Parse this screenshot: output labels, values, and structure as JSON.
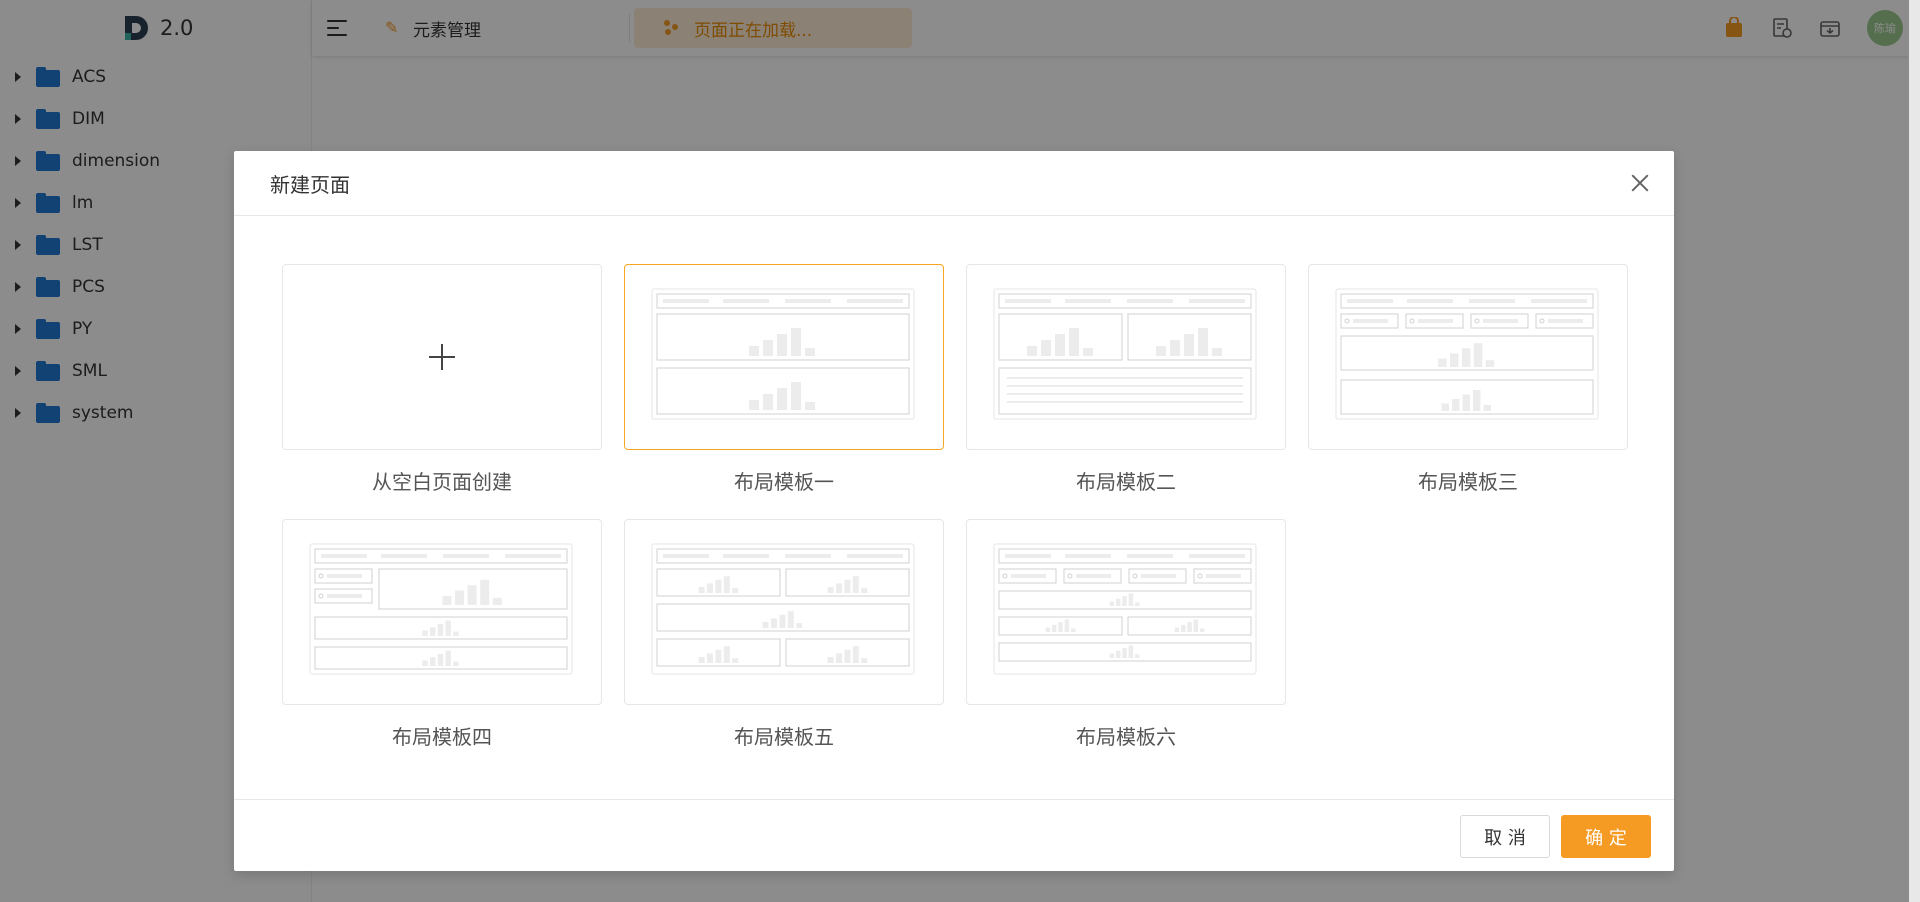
{
  "app": {
    "version": "2.0",
    "nav_title": "元素管理",
    "loading_text": "页面正在加载...",
    "avatar_text": "陈瑜"
  },
  "sidebar": {
    "items": [
      {
        "label": "ACS"
      },
      {
        "label": "DIM"
      },
      {
        "label": "dimension"
      },
      {
        "label": "lm"
      },
      {
        "label": "LST"
      },
      {
        "label": "PCS"
      },
      {
        "label": "PY"
      },
      {
        "label": "SML"
      },
      {
        "label": "system"
      }
    ]
  },
  "modal": {
    "title": "新建页面",
    "templates": [
      {
        "label": "从空白页面创建",
        "kind": "blank",
        "selected": false
      },
      {
        "label": "布局模板一",
        "kind": "layout-1",
        "selected": true
      },
      {
        "label": "布局模板二",
        "kind": "layout-2",
        "selected": false
      },
      {
        "label": "布局模板三",
        "kind": "layout-3",
        "selected": false
      },
      {
        "label": "布局模板四",
        "kind": "layout-4",
        "selected": false
      },
      {
        "label": "布局模板五",
        "kind": "layout-5",
        "selected": false
      },
      {
        "label": "布局模板六",
        "kind": "layout-6",
        "selected": false
      }
    ],
    "cancel_label": "取 消",
    "ok_label": "确 定"
  },
  "colors": {
    "accent": "#f59a23",
    "folder": "#1f78d1",
    "selected_border": "#f5a623"
  }
}
